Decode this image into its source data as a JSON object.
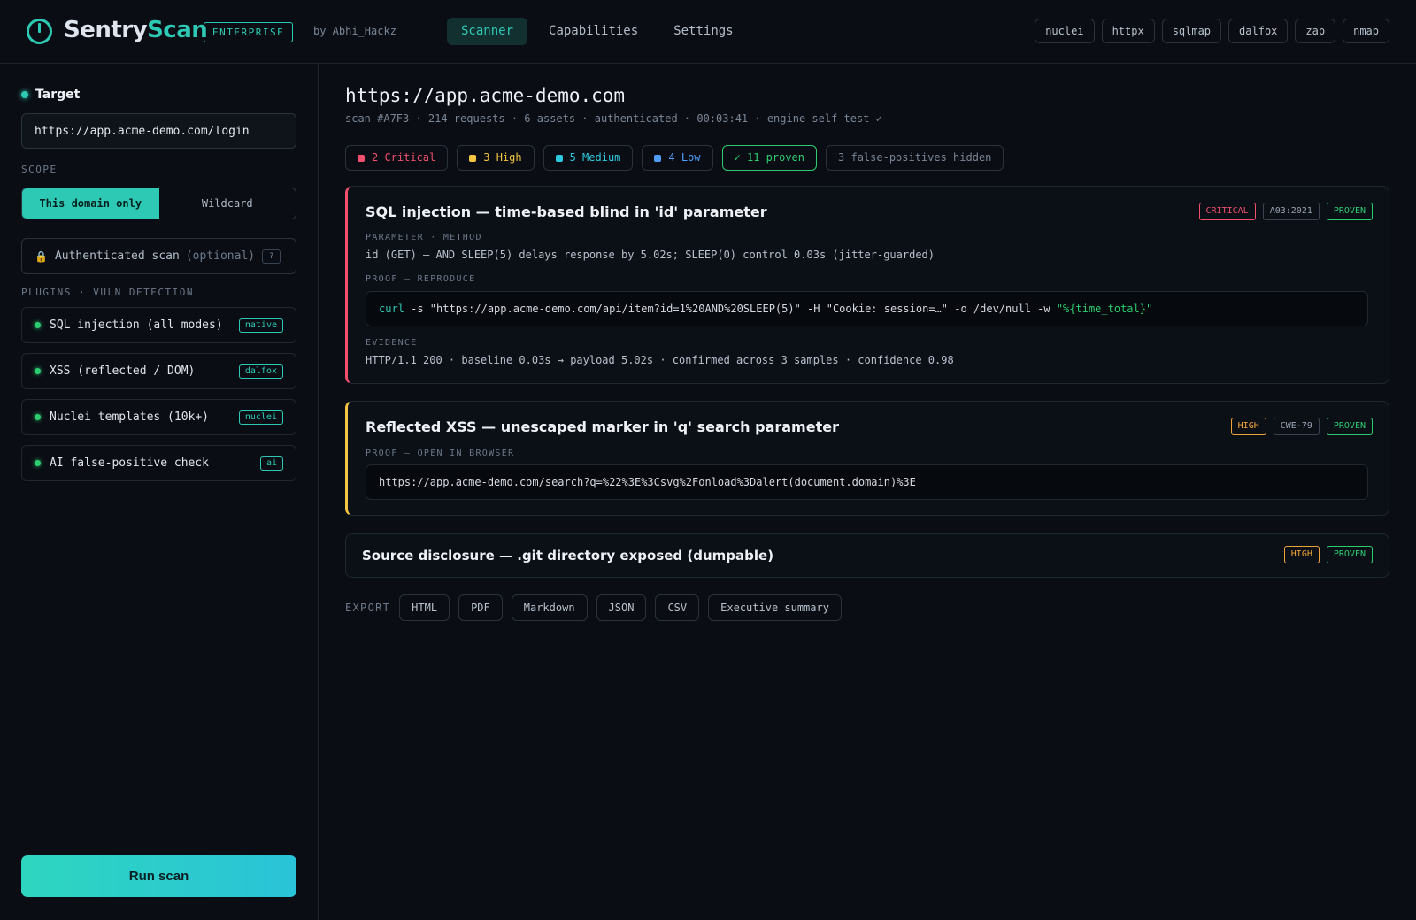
{
  "header": {
    "brand_part1": "Sentry",
    "brand_part2": "Scan",
    "edition": "ENTERPRISE",
    "byline": "by Abhi_Hackz",
    "nav": [
      "Scanner",
      "Capabilities",
      "Settings"
    ],
    "active_nav": "Scanner",
    "tools": [
      "nuclei",
      "httpx",
      "sqlmap",
      "dalfox",
      "zap",
      "nmap"
    ]
  },
  "sidebar": {
    "target_label": "Target",
    "target_value": "https://app.acme-demo.com/login",
    "scope_label": "SCOPE",
    "scope_options": [
      "This domain only",
      "Wildcard"
    ],
    "scope_selected": "This domain only",
    "auth_label": "Authenticated scan",
    "auth_optional": "(optional)",
    "auth_help": "?",
    "plugins_label": "PLUGINS · VULN DETECTION",
    "plugins": [
      {
        "name": "SQL injection (all modes)",
        "tag": "native"
      },
      {
        "name": "XSS (reflected / DOM)",
        "tag": "dalfox"
      },
      {
        "name": "Nuclei templates (10k+)",
        "tag": "nuclei"
      },
      {
        "name": "AI false-positive check",
        "tag": "ai"
      }
    ],
    "run_label": "Run scan"
  },
  "main": {
    "target": "https://app.acme-demo.com",
    "meta": "scan #A7F3 · 214 requests · 6 assets · authenticated · 00:03:41 · engine self-test ✓",
    "chips": {
      "critical": "2 Critical",
      "high": "3 High",
      "medium": "5 Medium",
      "low": "4 Low",
      "proven": "✓ 11 proven",
      "hidden": "3 false-positives hidden"
    },
    "findings": [
      {
        "title": "SQL injection — time-based blind in 'id' parameter",
        "severity": "CRITICAL",
        "ref": "A03:2021",
        "status": "PROVEN",
        "param_label": "PARAMETER · METHOD",
        "param_text": "id (GET) — AND SLEEP(5) delays response by 5.02s; SLEEP(0) control 0.03s (jitter-guarded)",
        "proof_label": "PROOF — REPRODUCE",
        "proof_cmd": "curl",
        "proof_args": " -s \"https://app.acme-demo.com/api/item?id=1%20AND%20SLEEP(5)\" -H \"Cookie: session=…\" -o /dev/null -w ",
        "proof_str": "\"%{time_total}\"",
        "evidence_label": "EVIDENCE",
        "evidence_text": "HTTP/1.1 200 · baseline 0.03s → payload 5.02s · confirmed across 3 samples · confidence 0.98"
      },
      {
        "title": "Reflected XSS — unescaped marker in 'q' search parameter",
        "severity": "HIGH",
        "ref": "CWE-79",
        "status": "PROVEN",
        "proof_label": "PROOF — OPEN IN BROWSER",
        "proof_url": "https://app.acme-demo.com/search?q=%22%3E%3Csvg%2Fonload%3Dalert(document.domain)%3E"
      },
      {
        "title": "Source disclosure — .git directory exposed (dumpable)",
        "severity": "HIGH",
        "status": "PROVEN"
      }
    ],
    "export_label": "EXPORT",
    "export_options": [
      "HTML",
      "PDF",
      "Markdown",
      "JSON",
      "CSV",
      "Executive summary"
    ]
  },
  "colors": {
    "accent": "#2ec9b5",
    "critical": "#f0506e",
    "high": "#f4c542",
    "medium": "#2ec9e0",
    "low": "#4f9dff",
    "proven": "#2ecc71",
    "background": "#0a0e14"
  },
  "icons": [
    "power-logo-icon",
    "lock-icon",
    "status-dot-icon"
  ]
}
